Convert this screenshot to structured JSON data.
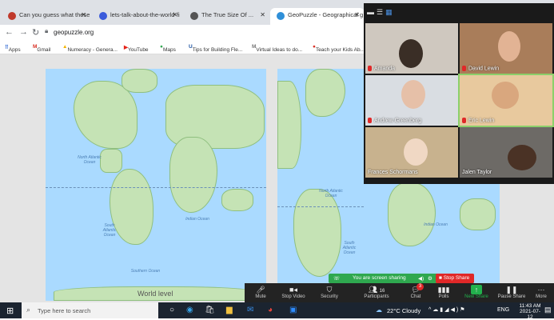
{
  "tabs": [
    {
      "label": "Can you guess what these fl",
      "fav": "#c0392b"
    },
    {
      "label": "lets-talk-about-the-world-fi",
      "fav": "#3b5bdb"
    },
    {
      "label": "The True Size Of ...",
      "fav": "#555"
    },
    {
      "label": "GeoPuzzle - Geographical g",
      "fav": "#2f8fd8"
    }
  ],
  "address": {
    "url": "geopuzzle.org"
  },
  "bookmarks": [
    "Apps",
    "Gmail",
    "Numeracy - Genera...",
    "YouTube",
    "Maps",
    "Tips for Building Fle...",
    "Virtual Ideas to do...",
    "Teach your Kids Ab..."
  ],
  "map_labels": {
    "north_atlantic": "North Atlantic Ocean",
    "south_atlantic": "South Atlantic Ocean",
    "indian": "Indian Ocean",
    "southern": "Southern Ocean",
    "bottom": "World level",
    "north_atlantic_2": "North Atlantic Ocean",
    "south_atlantic_2": "South Atlantic Ocean",
    "indian_2": "Indian Ocean"
  },
  "participants": [
    "Amanda",
    "David Lewin",
    "Andrew Greenberg",
    "Eric Lewin",
    "Frances Schormans",
    "Jalen Taylor"
  ],
  "share": {
    "status": "You are screen sharing",
    "stop": "Stop Share"
  },
  "controls": [
    {
      "label": "Mute",
      "icon": "mic-icon"
    },
    {
      "label": "Stop Video",
      "icon": "video-icon"
    },
    {
      "label": "Security",
      "icon": "shield-icon"
    },
    {
      "label": "Participants",
      "icon": "people-icon",
      "count": "16"
    },
    {
      "label": "Chat",
      "icon": "chat-icon",
      "badge": "3"
    },
    {
      "label": "Polls",
      "icon": "polls-icon"
    },
    {
      "label": "New Share",
      "icon": "share-icon"
    },
    {
      "label": "Pause Share",
      "icon": "pause-icon"
    },
    {
      "label": "More",
      "icon": "more-icon"
    }
  ],
  "taskbar": {
    "search": "Type here to search",
    "weather": "22°C  Cloudy",
    "lang": "ENG",
    "time": "11:43 AM",
    "date": "2021-07-12"
  },
  "colors": {
    "share_green": "#2fa84f",
    "stop_red": "#e02828",
    "new_share_green": "#22b14c"
  }
}
